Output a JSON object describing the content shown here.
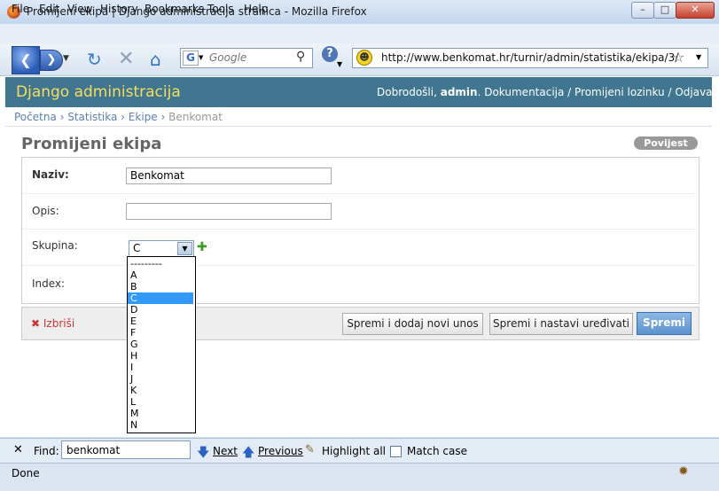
{
  "window": {
    "title": "Promijeni ekipa | Django administracija stranica - Mozilla Firefox",
    "controls": [
      "–",
      "□",
      "✕"
    ]
  },
  "menu": [
    "File",
    "Edit",
    "View",
    "History",
    "Bookmarks",
    "Tools",
    "Help"
  ],
  "toolbar": {
    "search_placeholder": "Google",
    "url": "http://www.benkomat.hr/turnir/admin/statistika/ekipa/3/"
  },
  "admin": {
    "brand": "Django administracija",
    "welcome": "Dobrodošli,",
    "user": "admin",
    "links": ". Dokumentacija / Promijeni lozinku / Odjava"
  },
  "breadcrumbs": {
    "items": [
      "Početna",
      "Statistika",
      "Ekipe"
    ],
    "current": "Benkomat",
    "separator": " › "
  },
  "page_title": "Promijeni ekipa",
  "history_button": "Povijest",
  "form": {
    "naziv_label": "Naziv:",
    "naziv_value": "Benkomat",
    "opis_label": "Opis:",
    "opis_value": "",
    "skupina_label": "Skupina:",
    "skupina_value": "C",
    "index_label": "Index:",
    "skupina_options": [
      "---------",
      "A",
      "B",
      "C",
      "D",
      "E",
      "F",
      "G",
      "H",
      "I",
      "J",
      "K",
      "L",
      "M",
      "N"
    ],
    "selected_option": "C"
  },
  "actions": {
    "delete": "Izbriši",
    "save_add": "Spremi i dodaj novi unos",
    "save_continue": "Spremi i nastavi uređivati",
    "save": "Spremi"
  },
  "findbar": {
    "label": "Find:",
    "value": "benkomat",
    "next": "Next",
    "previous": "Previous",
    "highlight": "Highlight all",
    "match_case": "Match case"
  },
  "status": "Done"
}
